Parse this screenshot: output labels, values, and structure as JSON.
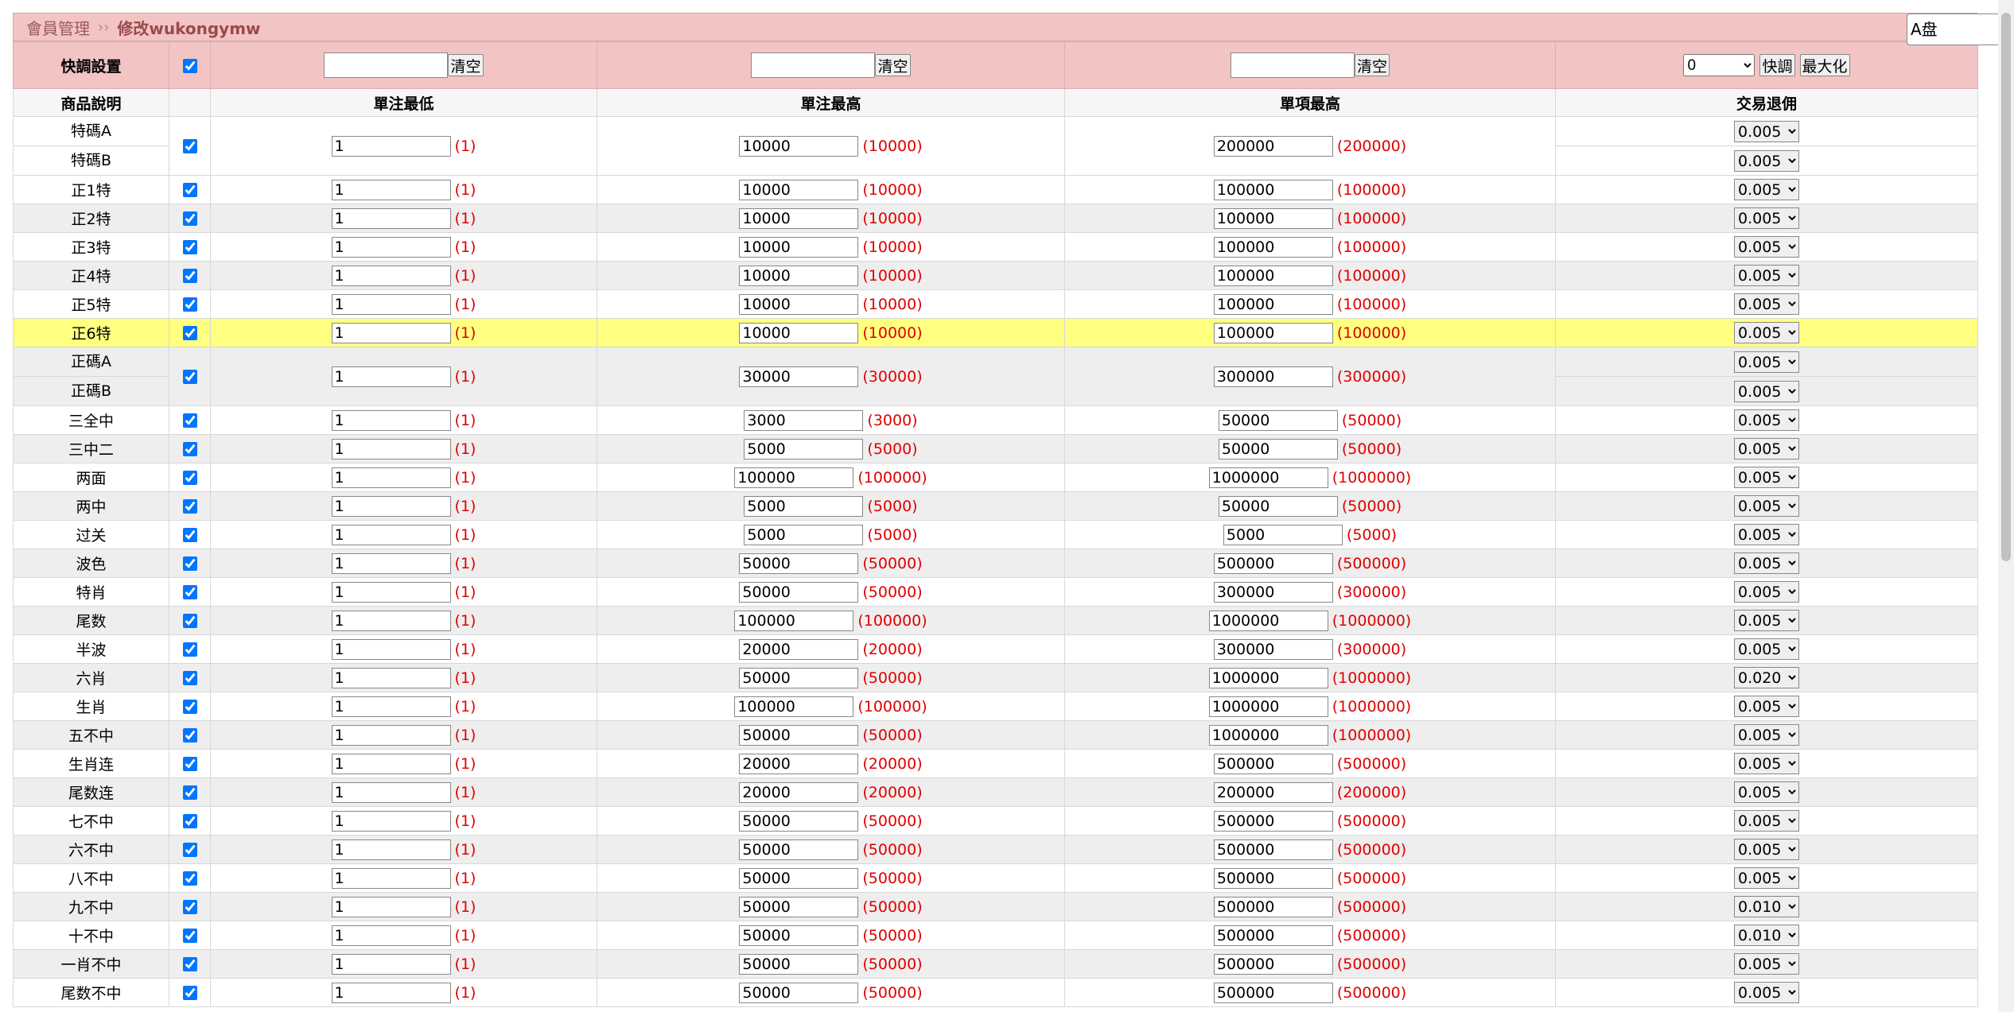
{
  "breadcrumb": {
    "section": "會員管理",
    "separator": "››",
    "current": "修改wukongymw"
  },
  "pan_select": {
    "value": "A盘"
  },
  "quick": {
    "label": "快調設置",
    "clear_label": "清空",
    "rebate_value": "0",
    "quick_button": "快調",
    "maximize_button": "最大化"
  },
  "headers": {
    "name": "商品說明",
    "min": "單注最低",
    "max": "單注最高",
    "item_max": "單項最高",
    "rebate": "交易退佣"
  },
  "rows": [
    {
      "names": [
        "特碼A",
        "特碼B"
      ],
      "min": "1",
      "min_lim": "(1)",
      "max": "10000",
      "max_lim": "(10000)",
      "item": "200000",
      "item_lim": "(200000)",
      "rebates": [
        "0.005",
        "0.005"
      ],
      "style": "odd"
    },
    {
      "names": [
        "正1特"
      ],
      "min": "1",
      "min_lim": "(1)",
      "max": "10000",
      "max_lim": "(10000)",
      "item": "100000",
      "item_lim": "(100000)",
      "rebates": [
        "0.005"
      ],
      "style": "odd"
    },
    {
      "names": [
        "正2特"
      ],
      "min": "1",
      "min_lim": "(1)",
      "max": "10000",
      "max_lim": "(10000)",
      "item": "100000",
      "item_lim": "(100000)",
      "rebates": [
        "0.005"
      ],
      "style": "even"
    },
    {
      "names": [
        "正3特"
      ],
      "min": "1",
      "min_lim": "(1)",
      "max": "10000",
      "max_lim": "(10000)",
      "item": "100000",
      "item_lim": "(100000)",
      "rebates": [
        "0.005"
      ],
      "style": "odd"
    },
    {
      "names": [
        "正4特"
      ],
      "min": "1",
      "min_lim": "(1)",
      "max": "10000",
      "max_lim": "(10000)",
      "item": "100000",
      "item_lim": "(100000)",
      "rebates": [
        "0.005"
      ],
      "style": "even"
    },
    {
      "names": [
        "正5特"
      ],
      "min": "1",
      "min_lim": "(1)",
      "max": "10000",
      "max_lim": "(10000)",
      "item": "100000",
      "item_lim": "(100000)",
      "rebates": [
        "0.005"
      ],
      "style": "odd"
    },
    {
      "names": [
        "正6特"
      ],
      "min": "1",
      "min_lim": "(1)",
      "max": "10000",
      "max_lim": "(10000)",
      "item": "100000",
      "item_lim": "(100000)",
      "rebates": [
        "0.005"
      ],
      "style": "hl"
    },
    {
      "names": [
        "正碼A",
        "正碼B"
      ],
      "min": "1",
      "min_lim": "(1)",
      "max": "30000",
      "max_lim": "(30000)",
      "item": "300000",
      "item_lim": "(300000)",
      "rebates": [
        "0.005",
        "0.005"
      ],
      "style": "even"
    },
    {
      "names": [
        "三全中"
      ],
      "min": "1",
      "min_lim": "(1)",
      "max": "3000",
      "max_lim": "(3000)",
      "item": "50000",
      "item_lim": "(50000)",
      "rebates": [
        "0.005"
      ],
      "style": "odd"
    },
    {
      "names": [
        "三中二"
      ],
      "min": "1",
      "min_lim": "(1)",
      "max": "5000",
      "max_lim": "(5000)",
      "item": "50000",
      "item_lim": "(50000)",
      "rebates": [
        "0.005"
      ],
      "style": "even"
    },
    {
      "names": [
        "两面"
      ],
      "min": "1",
      "min_lim": "(1)",
      "max": "100000",
      "max_lim": "(100000)",
      "item": "1000000",
      "item_lim": "(1000000)",
      "rebates": [
        "0.005"
      ],
      "style": "odd"
    },
    {
      "names": [
        "两中"
      ],
      "min": "1",
      "min_lim": "(1)",
      "max": "5000",
      "max_lim": "(5000)",
      "item": "50000",
      "item_lim": "(50000)",
      "rebates": [
        "0.005"
      ],
      "style": "even"
    },
    {
      "names": [
        "过关"
      ],
      "min": "1",
      "min_lim": "(1)",
      "max": "5000",
      "max_lim": "(5000)",
      "item": "5000",
      "item_lim": "(5000)",
      "rebates": [
        "0.005"
      ],
      "style": "odd"
    },
    {
      "names": [
        "波色"
      ],
      "min": "1",
      "min_lim": "(1)",
      "max": "50000",
      "max_lim": "(50000)",
      "item": "500000",
      "item_lim": "(500000)",
      "rebates": [
        "0.005"
      ],
      "style": "even"
    },
    {
      "names": [
        "特肖"
      ],
      "min": "1",
      "min_lim": "(1)",
      "max": "50000",
      "max_lim": "(50000)",
      "item": "300000",
      "item_lim": "(300000)",
      "rebates": [
        "0.005"
      ],
      "style": "odd"
    },
    {
      "names": [
        "尾数"
      ],
      "min": "1",
      "min_lim": "(1)",
      "max": "100000",
      "max_lim": "(100000)",
      "item": "1000000",
      "item_lim": "(1000000)",
      "rebates": [
        "0.005"
      ],
      "style": "even"
    },
    {
      "names": [
        "半波"
      ],
      "min": "1",
      "min_lim": "(1)",
      "max": "20000",
      "max_lim": "(20000)",
      "item": "300000",
      "item_lim": "(300000)",
      "rebates": [
        "0.005"
      ],
      "style": "odd"
    },
    {
      "names": [
        "六肖"
      ],
      "min": "1",
      "min_lim": "(1)",
      "max": "50000",
      "max_lim": "(50000)",
      "item": "1000000",
      "item_lim": "(1000000)",
      "rebates": [
        "0.020"
      ],
      "style": "even"
    },
    {
      "names": [
        "生肖"
      ],
      "min": "1",
      "min_lim": "(1)",
      "max": "100000",
      "max_lim": "(100000)",
      "item": "1000000",
      "item_lim": "(1000000)",
      "rebates": [
        "0.005"
      ],
      "style": "odd"
    },
    {
      "names": [
        "五不中"
      ],
      "min": "1",
      "min_lim": "(1)",
      "max": "50000",
      "max_lim": "(50000)",
      "item": "1000000",
      "item_lim": "(1000000)",
      "rebates": [
        "0.005"
      ],
      "style": "even"
    },
    {
      "names": [
        "生肖连"
      ],
      "min": "1",
      "min_lim": "(1)",
      "max": "20000",
      "max_lim": "(20000)",
      "item": "500000",
      "item_lim": "(500000)",
      "rebates": [
        "0.005"
      ],
      "style": "odd"
    },
    {
      "names": [
        "尾数连"
      ],
      "min": "1",
      "min_lim": "(1)",
      "max": "20000",
      "max_lim": "(20000)",
      "item": "200000",
      "item_lim": "(200000)",
      "rebates": [
        "0.005"
      ],
      "style": "even"
    },
    {
      "names": [
        "七不中"
      ],
      "min": "1",
      "min_lim": "(1)",
      "max": "50000",
      "max_lim": "(50000)",
      "item": "500000",
      "item_lim": "(500000)",
      "rebates": [
        "0.005"
      ],
      "style": "odd"
    },
    {
      "names": [
        "六不中"
      ],
      "min": "1",
      "min_lim": "(1)",
      "max": "50000",
      "max_lim": "(50000)",
      "item": "500000",
      "item_lim": "(500000)",
      "rebates": [
        "0.005"
      ],
      "style": "even"
    },
    {
      "names": [
        "八不中"
      ],
      "min": "1",
      "min_lim": "(1)",
      "max": "50000",
      "max_lim": "(50000)",
      "item": "500000",
      "item_lim": "(500000)",
      "rebates": [
        "0.005"
      ],
      "style": "odd"
    },
    {
      "names": [
        "九不中"
      ],
      "min": "1",
      "min_lim": "(1)",
      "max": "50000",
      "max_lim": "(50000)",
      "item": "500000",
      "item_lim": "(500000)",
      "rebates": [
        "0.010"
      ],
      "style": "even"
    },
    {
      "names": [
        "十不中"
      ],
      "min": "1",
      "min_lim": "(1)",
      "max": "50000",
      "max_lim": "(50000)",
      "item": "500000",
      "item_lim": "(500000)",
      "rebates": [
        "0.010"
      ],
      "style": "odd"
    },
    {
      "names": [
        "一肖不中"
      ],
      "min": "1",
      "min_lim": "(1)",
      "max": "50000",
      "max_lim": "(50000)",
      "item": "500000",
      "item_lim": "(500000)",
      "rebates": [
        "0.005"
      ],
      "style": "even"
    },
    {
      "names": [
        "尾数不中"
      ],
      "min": "1",
      "min_lim": "(1)",
      "max": "50000",
      "max_lim": "(50000)",
      "item": "500000",
      "item_lim": "(500000)",
      "rebates": [
        "0.005"
      ],
      "style": "odd"
    }
  ]
}
